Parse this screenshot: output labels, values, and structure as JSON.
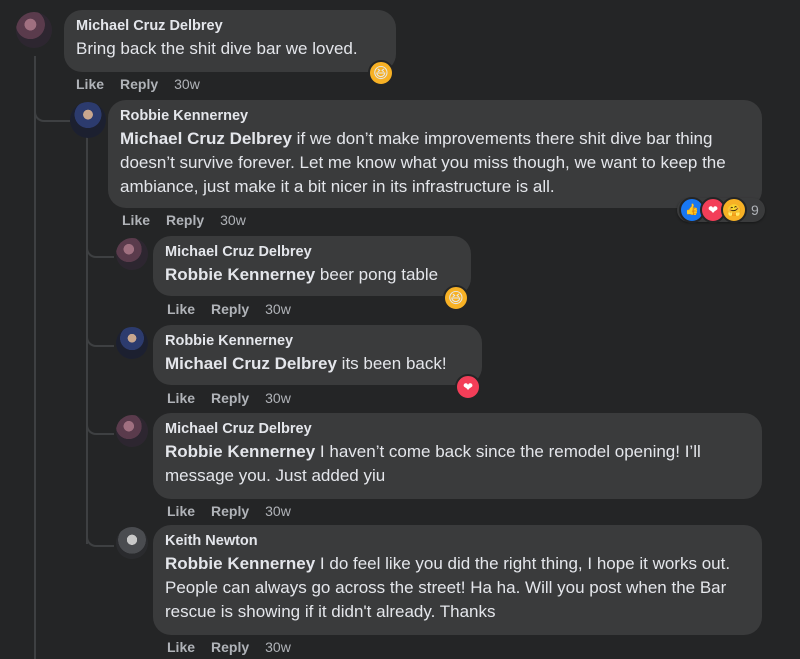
{
  "comments": [
    {
      "author": "Michael Cruz Delbrey",
      "text": "Bring back the shit dive bar we loved.",
      "like": "Like",
      "reply": "Reply",
      "time": "30w"
    },
    {
      "author": "Robbie Kennerney",
      "mention": "Michael Cruz Delbrey",
      "text": " if we don’t make improvements there shit dive bar thing doesn’t survive forever. Let me know what you miss though, we want to keep the ambiance, just make it a bit nicer in its infrastructure is all.",
      "like": "Like",
      "reply": "Reply",
      "time": "30w",
      "reaction_count": "9"
    },
    {
      "author": "Michael Cruz Delbrey",
      "mention": "Robbie Kennerney",
      "text": " beer pong table",
      "like": "Like",
      "reply": "Reply",
      "time": "30w"
    },
    {
      "author": "Robbie Kennerney",
      "mention": "Michael Cruz Delbrey",
      "text": " its been back!",
      "like": "Like",
      "reply": "Reply",
      "time": "30w"
    },
    {
      "author": "Michael Cruz Delbrey",
      "mention": "Robbie Kennerney",
      "text": " I haven’t come back since the remodel opening! I’ll message you. Just added yiu",
      "like": "Like",
      "reply": "Reply",
      "time": "30w"
    },
    {
      "author": "Keith Newton",
      "mention": "Robbie Kennerney",
      "text": " I do feel like you did the right thing, I hope it works out. People can always go across the street! Ha ha. Will you post when the Bar rescue is showing if it didn't already. Thanks",
      "like": "Like",
      "reply": "Reply",
      "time": "30w"
    }
  ],
  "icons": {
    "haha": "haha-reaction-icon",
    "love": "love-reaction-icon",
    "like": "like-reaction-icon",
    "care": "care-reaction-icon"
  },
  "colors": {
    "background": "#242526",
    "bubble": "#3a3b3c",
    "text": "#e4e6eb",
    "secondary": "#b0b3b8",
    "like_blue": "#1877f2",
    "love_red": "#f33e58",
    "haha_yellow": "#f7b125"
  }
}
